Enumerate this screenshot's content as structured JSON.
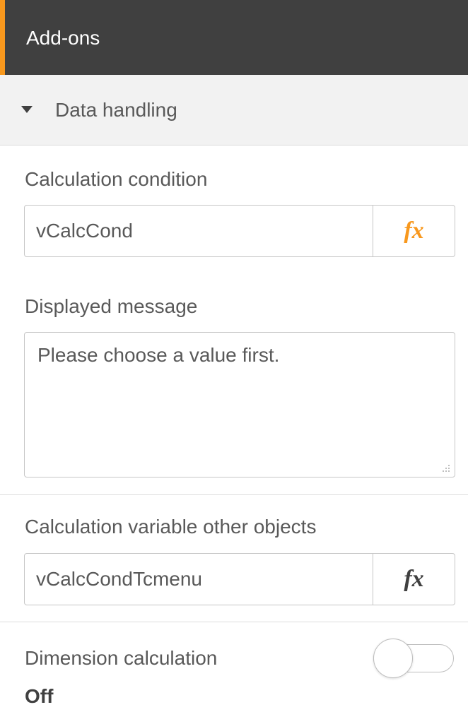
{
  "header": {
    "title": "Add-ons",
    "accent_color": "#f8981d",
    "background_color": "#404040"
  },
  "section": {
    "title": "Data handling",
    "expanded": true,
    "icon": "caret-down-icon"
  },
  "calculation_condition": {
    "label": "Calculation condition",
    "value": "vCalcCond",
    "fx_label": "fx",
    "fx_color": "#f8981d"
  },
  "displayed_message": {
    "label": "Displayed message",
    "value": "Please choose a value first."
  },
  "calculation_variable": {
    "label": "Calculation variable other objects",
    "value": "vCalcCondTcmenu",
    "fx_label": "fx",
    "fx_color": "#404040"
  },
  "dimension_calculation": {
    "label": "Dimension calculation",
    "status": "Off",
    "toggle_on": false
  }
}
